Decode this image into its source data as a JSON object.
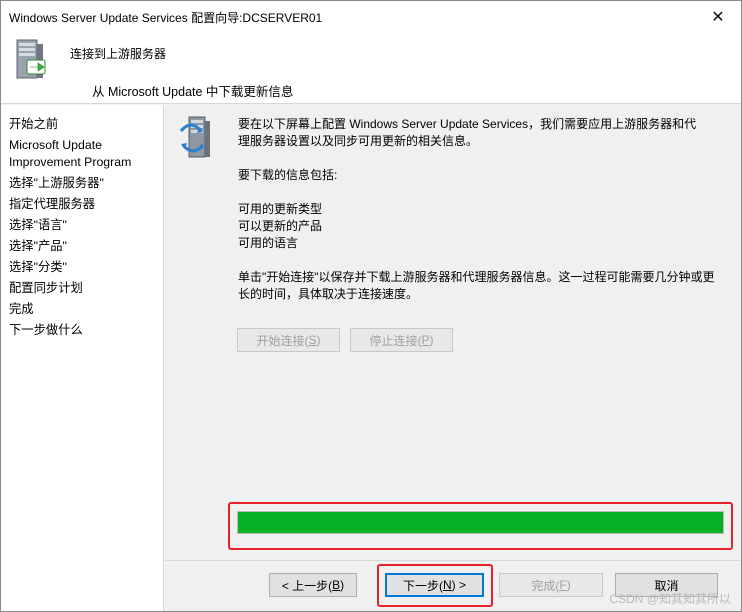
{
  "window": {
    "title": "Windows Server Update Services 配置向导:DCSERVER01",
    "close_glyph": "✕"
  },
  "header": {
    "title": "连接到上游服务器",
    "subtitle": "从 Microsoft Update 中下载更新信息",
    "icon": "server-arrow-icon"
  },
  "sidebar": {
    "items": [
      {
        "label": "开始之前"
      },
      {
        "label": "Microsoft Update"
      },
      {
        "label": "Improvement Program"
      },
      {
        "label": "选择\"上游服务器\""
      },
      {
        "label": "指定代理服务器"
      },
      {
        "label": "选择\"语言\""
      },
      {
        "label": "选择\"产品\""
      },
      {
        "label": "选择\"分类\""
      },
      {
        "label": "配置同步计划"
      },
      {
        "label": "完成"
      },
      {
        "label": "下一步做什么"
      }
    ]
  },
  "main": {
    "icon": "server-sync-icon",
    "intro_line1": "要在以下屏幕上配置 Windows Server Update Services，我们需要应用上游服务器和代",
    "intro_line2": "理服务器设置以及同步可用更新的相关信息。",
    "download_heading": "要下载的信息包括:",
    "info_items": [
      "可用的更新类型",
      "可以更新的产品",
      "可用的语言"
    ],
    "note_line1": "单击\"开始连接\"以保存并下载上游服务器和代理服务器信息。这一过程可能需要几分钟或更",
    "note_line2": "长的时间，具体取决于连接速度。",
    "start_button": {
      "text": "开始连接(",
      "key": "S",
      "suffix": ")"
    },
    "stop_button": {
      "text": "停止连接(",
      "key": "P",
      "suffix": ")"
    },
    "progress_fraction": 1.0
  },
  "footer": {
    "back": {
      "text": "< 上一步(",
      "key": "B",
      "suffix": ")"
    },
    "next": {
      "text": "下一步(",
      "key": "N",
      "suffix": ") >"
    },
    "finish": {
      "text": "完成(",
      "key": "F",
      "suffix": ")"
    },
    "cancel": {
      "text": "取消"
    }
  },
  "watermark": "CSDN @知其知其所以",
  "colors": {
    "progress_fill": "#06b025",
    "highlight_box": "#e8212a",
    "primary_border": "#0078d7"
  }
}
